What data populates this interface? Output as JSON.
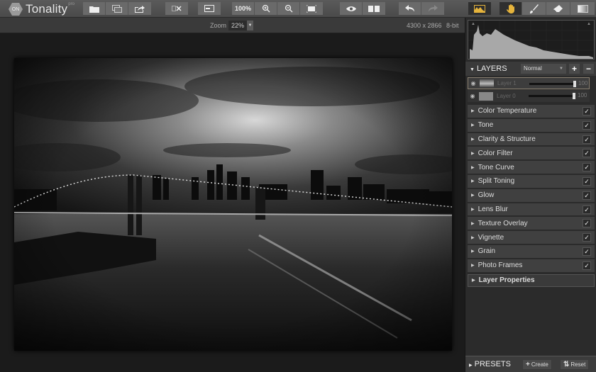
{
  "app": {
    "name": "Tonality",
    "edition_mark": "pro",
    "logo_glyph": "ON"
  },
  "toolbar": {
    "file_buttons": [
      {
        "name": "open-icon"
      },
      {
        "name": "batch-icon"
      },
      {
        "name": "export-icon"
      }
    ],
    "crop_button": {
      "name": "crop-icon"
    },
    "compare_panel_button": {
      "name": "panel-toggle-icon"
    },
    "zoom_100_label": "100%",
    "zoom_in": {
      "name": "zoom-in-icon"
    },
    "zoom_out": {
      "name": "zoom-out-icon"
    },
    "fit": {
      "name": "fit-screen-icon"
    },
    "preview": {
      "name": "eye-icon"
    },
    "split_view": {
      "name": "split-view-icon"
    },
    "undo": {
      "name": "undo-icon"
    },
    "redo": {
      "name": "redo-icon"
    },
    "right_tools": [
      {
        "name": "histogram-icon",
        "active": true
      },
      {
        "name": "hand-icon",
        "active": true
      },
      {
        "name": "brush-icon",
        "active": false
      },
      {
        "name": "eraser-icon",
        "active": false
      },
      {
        "name": "gradient-icon",
        "active": false
      }
    ],
    "accent_color": "#e6b43c"
  },
  "status": {
    "zoom_label": "Zoom",
    "zoom_value": "22%",
    "dimensions": "4300 x 2866",
    "bit_depth": "8-bit"
  },
  "layers": {
    "title": "LAYERS",
    "blend_mode": "Normal",
    "add_label": "+",
    "remove_label": "−",
    "items": [
      {
        "name": "Layer 1",
        "opacity": "100",
        "selected": true
      },
      {
        "name": "Layer 0",
        "opacity": "100",
        "selected": false
      }
    ]
  },
  "adjustments": [
    {
      "label": "Color Temperature",
      "checked": true
    },
    {
      "label": "Tone",
      "checked": true
    },
    {
      "label": "Clarity & Structure",
      "checked": true
    },
    {
      "label": "Color Filter",
      "checked": true
    },
    {
      "label": "Tone Curve",
      "checked": true
    },
    {
      "label": "Split Toning",
      "checked": true
    },
    {
      "label": "Glow",
      "checked": true
    },
    {
      "label": "Lens Blur",
      "checked": true
    },
    {
      "label": "Texture Overlay",
      "checked": true
    },
    {
      "label": "Vignette",
      "checked": true
    },
    {
      "label": "Grain",
      "checked": true
    },
    {
      "label": "Photo Frames",
      "checked": true
    }
  ],
  "layer_properties_label": "Layer Properties",
  "check_glyph": "✓",
  "presets": {
    "title": "PRESETS",
    "create_label": "Create",
    "reset_label": "Reset"
  },
  "photo": {
    "description": "Black and white photo of Brooklyn Bridge and Manhattan skyline at night"
  }
}
